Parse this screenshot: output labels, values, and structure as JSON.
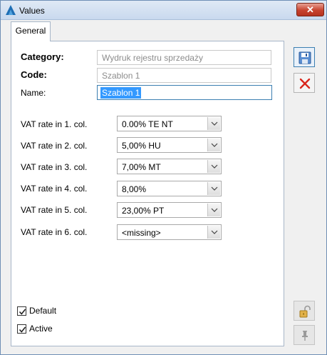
{
  "window": {
    "title": "Values",
    "close_label": "✕"
  },
  "tabs": [
    {
      "label": "General"
    }
  ],
  "form": {
    "category_label": "Category:",
    "category_value": "Wydruk rejestru sprzedaży",
    "code_label": "Code:",
    "code_value": "Szablon 1",
    "name_label": "Name:",
    "name_value": "Szablon 1"
  },
  "vat_rows": [
    {
      "label": "VAT rate in 1. col.",
      "value": "0.00% TE NT"
    },
    {
      "label": "VAT rate in 2. col.",
      "value": "5,00% HU"
    },
    {
      "label": "VAT rate in 3. col.",
      "value": "7,00% MT"
    },
    {
      "label": "VAT rate in 4. col.",
      "value": "8,00%"
    },
    {
      "label": "VAT rate in 5. col.",
      "value": "23,00% PT"
    },
    {
      "label": "VAT rate in 6. col.",
      "value": "<missing>"
    }
  ],
  "checkboxes": [
    {
      "label": "Default",
      "checked": true
    },
    {
      "label": "Active",
      "checked": true
    }
  ],
  "side_buttons": [
    {
      "icon": "save-icon"
    },
    {
      "icon": "cancel-icon"
    },
    {
      "icon": "unlock-icon"
    },
    {
      "icon": "pin-icon"
    }
  ],
  "colors": {
    "titlebar": "#c9d9ee",
    "close_button": "#c7432f",
    "selection": "#3399ff",
    "cancel_red": "#d9261c"
  }
}
